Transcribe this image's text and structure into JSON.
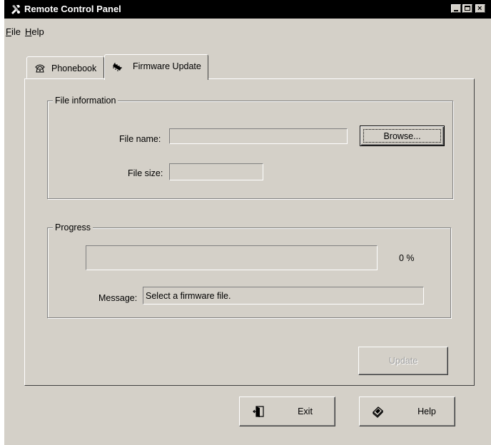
{
  "window": {
    "title": "Remote Control Panel",
    "icon": "tools-icon"
  },
  "menu": {
    "items": [
      {
        "label": "File",
        "mnemonic": "F",
        "rest": "ile"
      },
      {
        "label": "Help",
        "mnemonic": "H",
        "rest": "elp"
      }
    ]
  },
  "tabs": [
    {
      "label": "Phonebook",
      "icon": "phone-icon",
      "selected": false
    },
    {
      "label": "Firmware Update",
      "icon": "chip-icon",
      "selected": true
    }
  ],
  "file_info": {
    "group_label": "File information",
    "file_name_label": "File name:",
    "file_name_value": "",
    "file_size_label": "File size:",
    "file_size_value": "",
    "browse_label": "Browse..."
  },
  "progress": {
    "group_label": "Progress",
    "percent_text": "0 %",
    "percent_value": 0,
    "message_label": "Message:",
    "message_value": "Select a firmware file."
  },
  "actions": {
    "update_label": "Update",
    "update_enabled": false,
    "exit_label": "Exit",
    "exit_icon": "exit-door-icon",
    "help_label": "Help",
    "help_icon": "help-book-icon"
  },
  "colors": {
    "title_bar": "#000000",
    "face": "#d4d0c8",
    "progress_fill": "#000080"
  }
}
